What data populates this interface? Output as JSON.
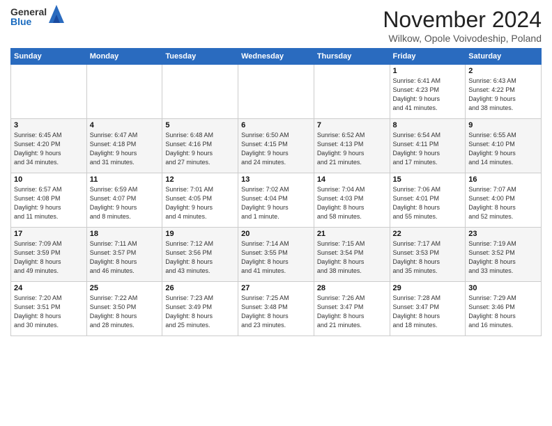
{
  "logo": {
    "general": "General",
    "blue": "Blue"
  },
  "title": {
    "month": "November 2024",
    "location": "Wilkow, Opole Voivodeship, Poland"
  },
  "headers": [
    "Sunday",
    "Monday",
    "Tuesday",
    "Wednesday",
    "Thursday",
    "Friday",
    "Saturday"
  ],
  "weeks": [
    [
      {
        "day": "",
        "info": ""
      },
      {
        "day": "",
        "info": ""
      },
      {
        "day": "",
        "info": ""
      },
      {
        "day": "",
        "info": ""
      },
      {
        "day": "",
        "info": ""
      },
      {
        "day": "1",
        "info": "Sunrise: 6:41 AM\nSunset: 4:23 PM\nDaylight: 9 hours\nand 41 minutes."
      },
      {
        "day": "2",
        "info": "Sunrise: 6:43 AM\nSunset: 4:22 PM\nDaylight: 9 hours\nand 38 minutes."
      }
    ],
    [
      {
        "day": "3",
        "info": "Sunrise: 6:45 AM\nSunset: 4:20 PM\nDaylight: 9 hours\nand 34 minutes."
      },
      {
        "day": "4",
        "info": "Sunrise: 6:47 AM\nSunset: 4:18 PM\nDaylight: 9 hours\nand 31 minutes."
      },
      {
        "day": "5",
        "info": "Sunrise: 6:48 AM\nSunset: 4:16 PM\nDaylight: 9 hours\nand 27 minutes."
      },
      {
        "day": "6",
        "info": "Sunrise: 6:50 AM\nSunset: 4:15 PM\nDaylight: 9 hours\nand 24 minutes."
      },
      {
        "day": "7",
        "info": "Sunrise: 6:52 AM\nSunset: 4:13 PM\nDaylight: 9 hours\nand 21 minutes."
      },
      {
        "day": "8",
        "info": "Sunrise: 6:54 AM\nSunset: 4:11 PM\nDaylight: 9 hours\nand 17 minutes."
      },
      {
        "day": "9",
        "info": "Sunrise: 6:55 AM\nSunset: 4:10 PM\nDaylight: 9 hours\nand 14 minutes."
      }
    ],
    [
      {
        "day": "10",
        "info": "Sunrise: 6:57 AM\nSunset: 4:08 PM\nDaylight: 9 hours\nand 11 minutes."
      },
      {
        "day": "11",
        "info": "Sunrise: 6:59 AM\nSunset: 4:07 PM\nDaylight: 9 hours\nand 8 minutes."
      },
      {
        "day": "12",
        "info": "Sunrise: 7:01 AM\nSunset: 4:05 PM\nDaylight: 9 hours\nand 4 minutes."
      },
      {
        "day": "13",
        "info": "Sunrise: 7:02 AM\nSunset: 4:04 PM\nDaylight: 9 hours\nand 1 minute."
      },
      {
        "day": "14",
        "info": "Sunrise: 7:04 AM\nSunset: 4:03 PM\nDaylight: 8 hours\nand 58 minutes."
      },
      {
        "day": "15",
        "info": "Sunrise: 7:06 AM\nSunset: 4:01 PM\nDaylight: 8 hours\nand 55 minutes."
      },
      {
        "day": "16",
        "info": "Sunrise: 7:07 AM\nSunset: 4:00 PM\nDaylight: 8 hours\nand 52 minutes."
      }
    ],
    [
      {
        "day": "17",
        "info": "Sunrise: 7:09 AM\nSunset: 3:59 PM\nDaylight: 8 hours\nand 49 minutes."
      },
      {
        "day": "18",
        "info": "Sunrise: 7:11 AM\nSunset: 3:57 PM\nDaylight: 8 hours\nand 46 minutes."
      },
      {
        "day": "19",
        "info": "Sunrise: 7:12 AM\nSunset: 3:56 PM\nDaylight: 8 hours\nand 43 minutes."
      },
      {
        "day": "20",
        "info": "Sunrise: 7:14 AM\nSunset: 3:55 PM\nDaylight: 8 hours\nand 41 minutes."
      },
      {
        "day": "21",
        "info": "Sunrise: 7:15 AM\nSunset: 3:54 PM\nDaylight: 8 hours\nand 38 minutes."
      },
      {
        "day": "22",
        "info": "Sunrise: 7:17 AM\nSunset: 3:53 PM\nDaylight: 8 hours\nand 35 minutes."
      },
      {
        "day": "23",
        "info": "Sunrise: 7:19 AM\nSunset: 3:52 PM\nDaylight: 8 hours\nand 33 minutes."
      }
    ],
    [
      {
        "day": "24",
        "info": "Sunrise: 7:20 AM\nSunset: 3:51 PM\nDaylight: 8 hours\nand 30 minutes."
      },
      {
        "day": "25",
        "info": "Sunrise: 7:22 AM\nSunset: 3:50 PM\nDaylight: 8 hours\nand 28 minutes."
      },
      {
        "day": "26",
        "info": "Sunrise: 7:23 AM\nSunset: 3:49 PM\nDaylight: 8 hours\nand 25 minutes."
      },
      {
        "day": "27",
        "info": "Sunrise: 7:25 AM\nSunset: 3:48 PM\nDaylight: 8 hours\nand 23 minutes."
      },
      {
        "day": "28",
        "info": "Sunrise: 7:26 AM\nSunset: 3:47 PM\nDaylight: 8 hours\nand 21 minutes."
      },
      {
        "day": "29",
        "info": "Sunrise: 7:28 AM\nSunset: 3:47 PM\nDaylight: 8 hours\nand 18 minutes."
      },
      {
        "day": "30",
        "info": "Sunrise: 7:29 AM\nSunset: 3:46 PM\nDaylight: 8 hours\nand 16 minutes."
      }
    ]
  ]
}
